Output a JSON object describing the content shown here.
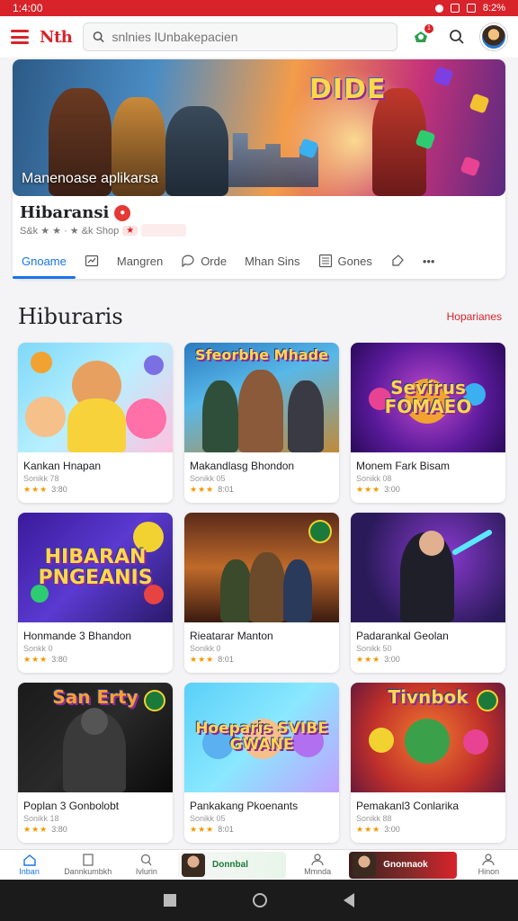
{
  "status_bar": {
    "time": "1:4:00",
    "battery": "8:2%"
  },
  "header": {
    "logo": "Nth",
    "search_placeholder": "snlnies lUnbakepacien",
    "notif_count": "1"
  },
  "featured": {
    "banner_game_title": "DIDE",
    "banner_caption": "Manenoase aplikarsa",
    "app_title": "Hibaransi",
    "app_meta": "S&k ★ ★ · ★ &k Shop",
    "app_meta_tag": "★"
  },
  "tabs": [
    {
      "label": "Gnoame",
      "active": true
    },
    {
      "label": "",
      "icon": "chart-icon"
    },
    {
      "label": "Mangren"
    },
    {
      "label": "Orde",
      "icon": "chat-icon"
    },
    {
      "label": "Mhan Sins"
    },
    {
      "label": "Gones",
      "icon": "list-icon"
    },
    {
      "label": "",
      "icon": "tag-icon"
    },
    {
      "label": "•••",
      "icon": "more-icon"
    }
  ],
  "section": {
    "title": "Hiburaris",
    "link": "Hoparianes"
  },
  "games": [
    {
      "name": "Kankan Hnapan",
      "sub": "Sonikk 78",
      "rating": "3:80",
      "art": ""
    },
    {
      "name": "Makandlasg Bhondon",
      "sub": "Sonikk 05",
      "rating": "8:01",
      "art": "Sfeorbhe Mhade"
    },
    {
      "name": "Monem Fark Bisam",
      "sub": "Sonikk 08",
      "rating": "3:00",
      "art": "Sevirus FOMAEO"
    },
    {
      "name": "Honmande 3 Bhandon",
      "sub": "Sonkk 0",
      "rating": "3:80",
      "art": "HIBARAN PNGEANIS"
    },
    {
      "name": "Rieatarar Manton",
      "sub": "Sonikk 0",
      "rating": "8:01",
      "art": ""
    },
    {
      "name": "Padarankal Geolan",
      "sub": "Sonikk 50",
      "rating": "3:00",
      "art": ""
    },
    {
      "name": "Poplan 3 Gonbolobt",
      "sub": "Sonikk 18",
      "rating": "3:80",
      "art": "San Erty"
    },
    {
      "name": "Pankakang Pkoenants",
      "sub": "Sonikk 05",
      "rating": "8:01",
      "art": "Hoeparis SVIBE GWANE"
    },
    {
      "name": "Pemakanl3 Conlarika",
      "sub": "Sonikk 88",
      "rating": "3:00",
      "art": "Tivnbok"
    }
  ],
  "bottom_nav": [
    {
      "label": "Inban",
      "active": true
    },
    {
      "label": "Dannkumbkh"
    },
    {
      "label": "Ivlurin"
    },
    {
      "label": "Donnbal",
      "promo": true,
      "promo_style": "green"
    },
    {
      "label": "Mmnda"
    },
    {
      "label": "Gnonnaok",
      "promo": true,
      "promo_style": "red"
    },
    {
      "label": "Hinon"
    }
  ],
  "colors": {
    "brand": "#d8232a",
    "accent": "#1a73e8",
    "star": "#f29900"
  }
}
